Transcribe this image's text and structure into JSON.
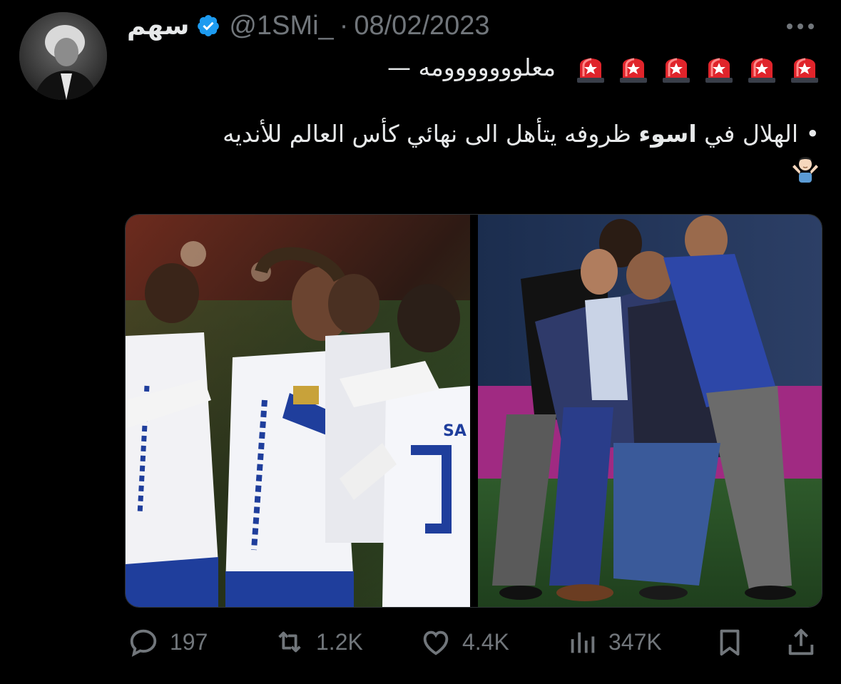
{
  "author": {
    "display_name": "سهم",
    "handle": "@1SMi_",
    "separator": "·",
    "date": "08/02/2023"
  },
  "tweet": {
    "line1_text": "— معلووووووومه",
    "line1_emoji": "police-light-emoji",
    "line1_emoji_count": 6,
    "bullet": "•",
    "text_before_bold": "الهلال في",
    "bold_word": "اسوء",
    "text_after_bold": "ظروفه يتأهل الى نهائي كأس العالم للأنديه",
    "trailing_emoji": "person-shrugging-emoji"
  },
  "media": {
    "images": [
      "team-celebration-photo",
      "staff-celebration-photo"
    ]
  },
  "actions": {
    "reply_count": "197",
    "retweet_count": "1.2K",
    "like_count": "4.4K",
    "view_count": "347K"
  },
  "icons": {
    "verified": "verified-badge-icon",
    "more": "more-icon",
    "reply": "reply-icon",
    "retweet": "retweet-icon",
    "like": "heart-icon",
    "views": "views-icon",
    "bookmark": "bookmark-icon",
    "share": "share-icon"
  },
  "colors": {
    "background": "#000000",
    "text": "#e7e9ea",
    "muted": "#71767b",
    "verified": "#1d9bf0",
    "siren": "#e0242b",
    "al_hilal_blue": "#1f3e9c"
  }
}
